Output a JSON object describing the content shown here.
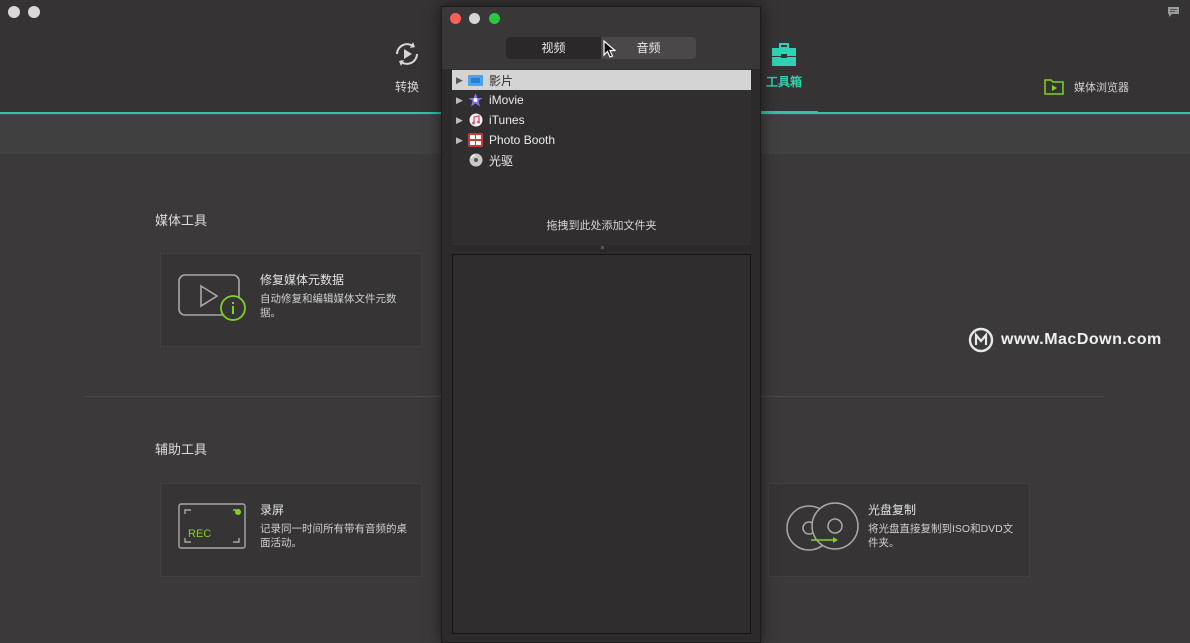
{
  "app": {
    "nav": {
      "convert": "转换",
      "toolbox": "工具箱"
    },
    "media_browser": "媒体浏览器",
    "sections": {
      "media_tools": "媒体工具",
      "aux_tools": "辅助工具"
    },
    "cards": {
      "repair": {
        "title": "修复媒体元数据",
        "desc": "自动修复和编辑媒体文件元数据。"
      },
      "record": {
        "title": "录屏",
        "desc": "记录同一时间所有带有音频的桌面活动。",
        "icon_text": "REC"
      },
      "disc": {
        "title": "光盘复制",
        "desc": "将光盘直接复制到ISO和DVD文件夹。"
      }
    },
    "watermark": "www.MacDown.com",
    "accent": "#2fc2a6"
  },
  "browser": {
    "tabs": {
      "video": "视频",
      "audio": "音频"
    },
    "tree": [
      {
        "label": "影片",
        "expandable": true,
        "selected": true
      },
      {
        "label": "iMovie",
        "expandable": true,
        "selected": false
      },
      {
        "label": "iTunes",
        "expandable": true,
        "selected": false
      },
      {
        "label": "Photo Booth",
        "expandable": true,
        "selected": false
      },
      {
        "label": "光驱",
        "expandable": false,
        "selected": false
      }
    ],
    "drop_hint": "拖拽到此处添加文件夹"
  }
}
